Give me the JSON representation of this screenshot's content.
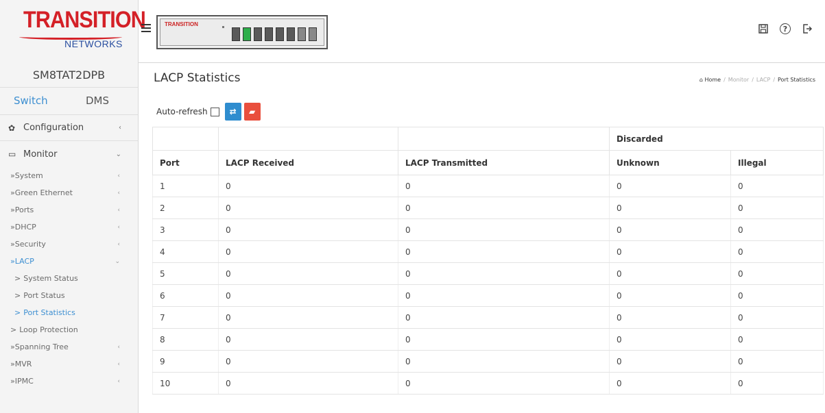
{
  "brand": {
    "logo_main": "TRANSITION",
    "logo_sub": "NETWORKS"
  },
  "device_logo": "TRANSITION",
  "top_icons": [
    "save-icon",
    "help-icon",
    "logout-icon"
  ],
  "sidebar": {
    "model": "SM8TAT2DPB",
    "tabs": [
      {
        "label": "Switch",
        "active": true
      },
      {
        "label": "DMS",
        "active": false
      }
    ],
    "configuration": "Configuration",
    "monitor": "Monitor",
    "items": [
      {
        "label": "System"
      },
      {
        "label": "Green Ethernet"
      },
      {
        "label": "Ports"
      },
      {
        "label": "DHCP"
      },
      {
        "label": "Security"
      },
      {
        "label": "LACP"
      },
      {
        "label": "System Status"
      },
      {
        "label": "Port Status"
      },
      {
        "label": "Port Statistics"
      },
      {
        "label": "Loop Protection"
      },
      {
        "label": "Spanning Tree"
      },
      {
        "label": "MVR"
      },
      {
        "label": "IPMC"
      }
    ]
  },
  "page": {
    "title": "LACP Statistics",
    "breadcrumb": {
      "home": "Home",
      "monitor": "Monitor",
      "lacp": "LACP",
      "current": "Port Statistics"
    },
    "auto_refresh_label": "Auto-refresh"
  },
  "table": {
    "group_header": "Discarded",
    "headers": {
      "port": "Port",
      "received": "LACP Received",
      "transmitted": "LACP Transmitted",
      "unknown": "Unknown",
      "illegal": "Illegal"
    },
    "rows": [
      {
        "port": "1",
        "received": "0",
        "transmitted": "0",
        "unknown": "0",
        "illegal": "0"
      },
      {
        "port": "2",
        "received": "0",
        "transmitted": "0",
        "unknown": "0",
        "illegal": "0"
      },
      {
        "port": "3",
        "received": "0",
        "transmitted": "0",
        "unknown": "0",
        "illegal": "0"
      },
      {
        "port": "4",
        "received": "0",
        "transmitted": "0",
        "unknown": "0",
        "illegal": "0"
      },
      {
        "port": "5",
        "received": "0",
        "transmitted": "0",
        "unknown": "0",
        "illegal": "0"
      },
      {
        "port": "6",
        "received": "0",
        "transmitted": "0",
        "unknown": "0",
        "illegal": "0"
      },
      {
        "port": "7",
        "received": "0",
        "transmitted": "0",
        "unknown": "0",
        "illegal": "0"
      },
      {
        "port": "8",
        "received": "0",
        "transmitted": "0",
        "unknown": "0",
        "illegal": "0"
      },
      {
        "port": "9",
        "received": "0",
        "transmitted": "0",
        "unknown": "0",
        "illegal": "0"
      },
      {
        "port": "10",
        "received": "0",
        "transmitted": "0",
        "unknown": "0",
        "illegal": "0"
      }
    ]
  },
  "colors": {
    "accent": "#3d8fd1",
    "brand_red": "#d42027",
    "refresh_btn": "#2f8dcf",
    "clear_btn": "#e94f3d"
  }
}
